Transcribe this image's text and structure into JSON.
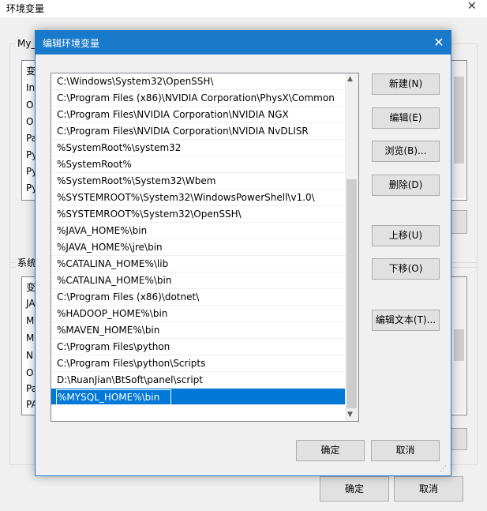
{
  "background_window": {
    "title": "环境变量",
    "close_glyph": "✕",
    "user_group_label": "My_",
    "user_list_items": [
      "变",
      "In",
      "O",
      "O",
      "Pa",
      "Py",
      "Py",
      "Py"
    ],
    "system_group_label": "系统",
    "system_list_items": [
      "变",
      "JA",
      "M",
      "M",
      "N",
      "O",
      "Pa",
      "PA"
    ],
    "ok_label": "确定",
    "cancel_label": "取消"
  },
  "dialog": {
    "title": "编辑环境变量",
    "close_glyph": "✕",
    "paths": [
      "C:\\Windows\\System32\\OpenSSH\\",
      "C:\\Program Files (x86)\\NVIDIA Corporation\\PhysX\\Common",
      "C:\\Program Files\\NVIDIA Corporation\\NVIDIA NGX",
      "C:\\Program Files\\NVIDIA Corporation\\NVIDIA NvDLISR",
      "%SystemRoot%\\system32",
      "%SystemRoot%",
      "%SystemRoot%\\System32\\Wbem",
      "%SYSTEMROOT%\\System32\\WindowsPowerShell\\v1.0\\",
      "%SYSTEMROOT%\\System32\\OpenSSH\\",
      "%JAVA_HOME%\\bin",
      "%JAVA_HOME%\\jre\\bin",
      "%CATALINA_HOME%\\lib",
      "%CATALINA_HOME%\\bin",
      "C:\\Program Files (x86)\\dotnet\\",
      "%HADOOP_HOME%\\bin",
      "%MAVEN_HOME%\\bin",
      "C:\\Program Files\\python",
      "C:\\Program Files\\python\\Scripts",
      "D:\\RuanJian\\BtSoft\\panel\\script"
    ],
    "editing_value": "%MYSQL_HOME%\\bin",
    "buttons": {
      "new": "新建(N)",
      "edit": "编辑(E)",
      "browse": "浏览(B)...",
      "delete": "删除(D)",
      "move_up": "上移(U)",
      "move_down": "下移(O)",
      "edit_text": "编辑文本(T)...",
      "ok": "确定",
      "cancel": "取消"
    }
  },
  "colors": {
    "titlebar": "#1979ca",
    "selection": "#0078d7"
  }
}
